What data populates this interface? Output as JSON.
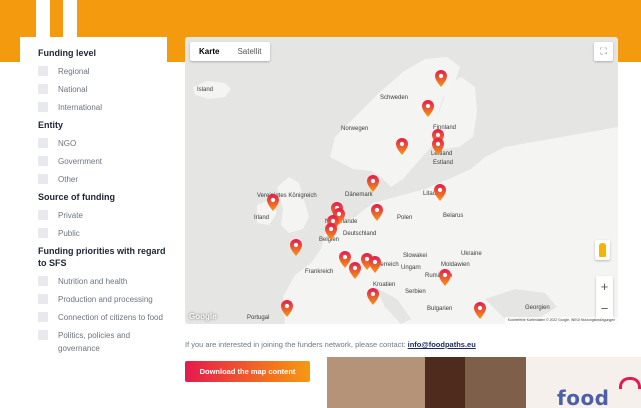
{
  "sidebar": {
    "funding_level": {
      "title": "Funding level",
      "options": [
        "Regional",
        "National",
        "International"
      ]
    },
    "entity": {
      "title": "Entity",
      "options": [
        "NGO",
        "Government",
        "Other"
      ]
    },
    "source": {
      "title": "Source of funding",
      "options": [
        "Private",
        "Public"
      ]
    },
    "priorities": {
      "title": "Funding priorities with regard to SFS",
      "options": [
        "Nutrition and health",
        "Production and processing",
        "Connection of citizens to food",
        "Politics, policies and governance"
      ]
    }
  },
  "map": {
    "tabs": {
      "map": "Karte",
      "satellite": "Satellit"
    },
    "zoom_in": "+",
    "zoom_out": "−",
    "fullscreen": "⛶",
    "google_logo": "Google",
    "attribution": "Kurzbefehle   Kartendaten © 2022 Google, INEGI   Nutzungsbedingungen",
    "labels": {
      "island": "Island",
      "schweden": "Schweden",
      "finnland": "Finnland",
      "norwegen": "Norwegen",
      "estland": "Estland",
      "lettland": "Lettland",
      "litauen": "Litauen",
      "daenemark": "Dänemark",
      "vk": "Vereinigtes Königreich",
      "irland": "Irland",
      "niederlande": "Niederlande",
      "belgien": "Belgien",
      "deutschland": "Deutschland",
      "polen": "Polen",
      "belarus": "Belarus",
      "slowakei": "Slowakei",
      "ukraine": "Ukraine",
      "moldawien": "Moldawien",
      "frankreich": "Frankreich",
      "oesterreich": "Österreich",
      "ungarn": "Ungarn",
      "rumaenien": "Rumänien",
      "kroatien": "Kroatien",
      "serbien": "Serbien",
      "bulgarien": "Bulgarien",
      "georgien": "Georgien",
      "portugal": "Portugal"
    },
    "marker_colors": {
      "top": "#e6194d",
      "bottom": "#f39a12"
    }
  },
  "contact": {
    "text": "If you are interested in joining the funders network, please contact: ",
    "email": "info@foodpaths.eu"
  },
  "download_button": "Download the map content",
  "photo": {
    "logo_text": "food"
  },
  "colors": {
    "brand_orange": "#f39a0f",
    "accent_red": "#e6194d",
    "navy": "#1d2433"
  }
}
